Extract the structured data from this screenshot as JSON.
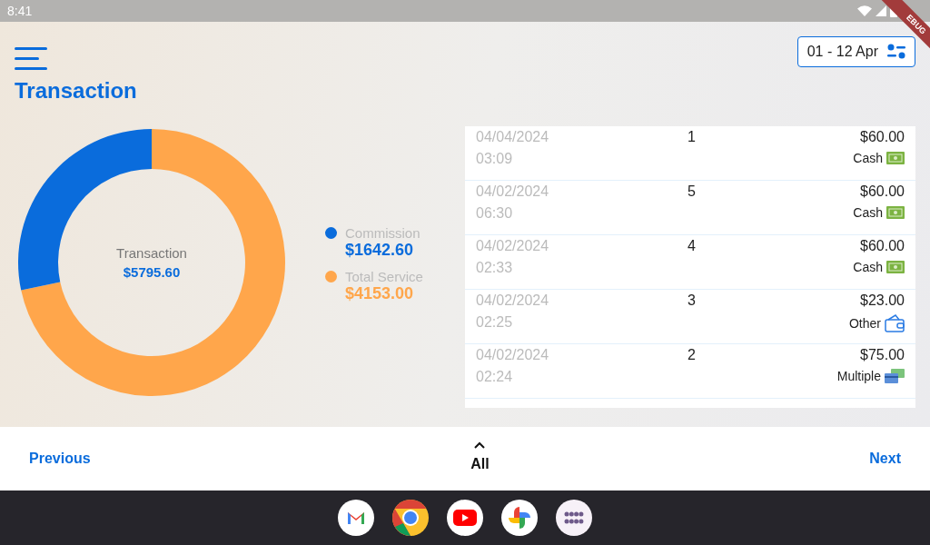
{
  "status_bar": {
    "time": "8:41"
  },
  "debug_ribbon": {
    "label": "EBUG"
  },
  "header": {
    "title": "Transaction",
    "date_range": "01 - 12 Apr"
  },
  "summary": {
    "center_value": "$5795.60",
    "legend": [
      {
        "value": "$1642.60",
        "color": "#0a6cdc"
      },
      {
        "value": "$4153.00",
        "color": "#ffa64b"
      }
    ],
    "chart_data": {
      "type": "donut",
      "categories": [
        "Commission",
        "Total Service"
      ],
      "series": [
        {
          "name": "Transaction",
          "values": [
            28.34,
            71.66
          ]
        }
      ]
    }
  },
  "transactions": [
    {
      "date": "04/04/2024",
      "time": "03:09",
      "count": "1",
      "amount": "$60.00",
      "method": "Cash",
      "kind": "cash"
    },
    {
      "date": "04/02/2024",
      "time": "06:30",
      "count": "5",
      "amount": "$60.00",
      "method": "Cash",
      "kind": "cash"
    },
    {
      "date": "04/02/2024",
      "time": "02:33",
      "count": "4",
      "amount": "$60.00",
      "method": "Cash",
      "kind": "cash"
    },
    {
      "date": "04/02/2024",
      "time": "02:25",
      "count": "3",
      "amount": "$23.00",
      "method": "Other",
      "kind": "other"
    },
    {
      "date": "04/02/2024",
      "time": "02:24",
      "count": "2",
      "amount": "$75.00",
      "method": "Multiple",
      "kind": "multiple"
    }
  ],
  "bottom_nav": {
    "previous": "Previous",
    "current": "All",
    "next": "Next"
  },
  "dock": [
    {
      "kind": "mail"
    },
    {
      "kind": "browser"
    },
    {
      "kind": "video"
    },
    {
      "kind": "photos"
    },
    {
      "kind": "apps"
    }
  ]
}
